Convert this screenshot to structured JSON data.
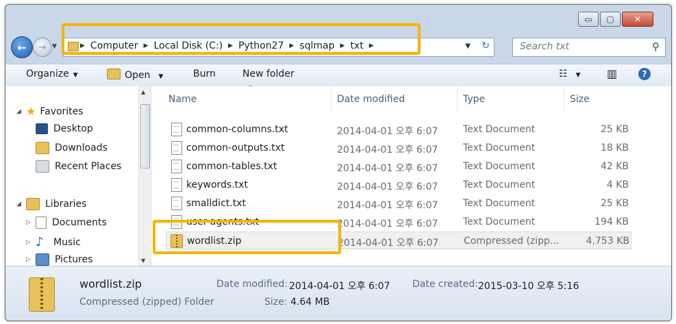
{
  "window": {
    "minimize": "▭",
    "maximize": "▢",
    "close": "✕"
  },
  "address": {
    "crumbs": [
      "Computer",
      "Local Disk (C:)",
      "Python27",
      "sqlmap",
      "txt"
    ],
    "separator": "▶",
    "dropdown": "▼",
    "refresh": "↻"
  },
  "search": {
    "placeholder": "Search txt",
    "icon": "⚲"
  },
  "toolbar": {
    "organize": "Organize",
    "open": "Open",
    "burn": "Burn",
    "new_folder": "New folder",
    "caret": "▼",
    "views": "☷",
    "preview": "▥",
    "help": "?"
  },
  "nav": {
    "favorites": "Favorites",
    "desktop": "Desktop",
    "downloads": "Downloads",
    "recent": "Recent Places",
    "libraries": "Libraries",
    "documents": "Documents",
    "music": "Music",
    "pictures": "Pictures",
    "expanded": "◢",
    "collapsed": "▷"
  },
  "columns": {
    "name": "Name",
    "date": "Date modified",
    "type": "Type",
    "size": "Size"
  },
  "files": [
    {
      "name": "common-columns.txt",
      "date": "2014-04-01 오후 6:07",
      "type": "Text Document",
      "size": "25 KB"
    },
    {
      "name": "common-outputs.txt",
      "date": "2014-04-01 오후 6:07",
      "type": "Text Document",
      "size": "18 KB"
    },
    {
      "name": "common-tables.txt",
      "date": "2014-04-01 오후 6:07",
      "type": "Text Document",
      "size": "42 KB"
    },
    {
      "name": "keywords.txt",
      "date": "2014-04-01 오후 6:07",
      "type": "Text Document",
      "size": "4 KB"
    },
    {
      "name": "smalldict.txt",
      "date": "2014-04-01 오후 6:07",
      "type": "Text Document",
      "size": "25 KB"
    },
    {
      "name": "user-agents.txt",
      "date": "2014-04-01 오후 6:07",
      "type": "Text Document",
      "size": "194 KB"
    },
    {
      "name": "wordlist.zip",
      "date": "2014-04-01 오후 6:07",
      "type": "Compressed (zipp...",
      "size": "4,753 KB"
    }
  ],
  "details": {
    "name": "wordlist.zip",
    "kind": "Compressed (zipped) Folder",
    "modified_label": "Date modified:",
    "modified_value": "2014-04-01 오후 6:07",
    "created_label": "Date created:",
    "created_value": "2015-03-10 오후 5:16",
    "size_label": "Size:",
    "size_value": "4.64 MB"
  },
  "colors": {
    "highlight": "#f5b400",
    "accent": "#2b6ab4"
  }
}
